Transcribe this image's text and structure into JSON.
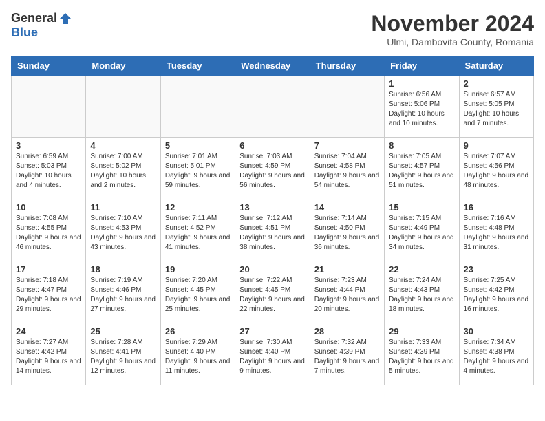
{
  "header": {
    "logo_general": "General",
    "logo_blue": "Blue",
    "month_title": "November 2024",
    "location": "Ulmi, Dambovita County, Romania"
  },
  "days_of_week": [
    "Sunday",
    "Monday",
    "Tuesday",
    "Wednesday",
    "Thursday",
    "Friday",
    "Saturday"
  ],
  "weeks": [
    [
      {
        "day": "",
        "info": ""
      },
      {
        "day": "",
        "info": ""
      },
      {
        "day": "",
        "info": ""
      },
      {
        "day": "",
        "info": ""
      },
      {
        "day": "",
        "info": ""
      },
      {
        "day": "1",
        "info": "Sunrise: 6:56 AM\nSunset: 5:06 PM\nDaylight: 10 hours and 10 minutes."
      },
      {
        "day": "2",
        "info": "Sunrise: 6:57 AM\nSunset: 5:05 PM\nDaylight: 10 hours and 7 minutes."
      }
    ],
    [
      {
        "day": "3",
        "info": "Sunrise: 6:59 AM\nSunset: 5:03 PM\nDaylight: 10 hours and 4 minutes."
      },
      {
        "day": "4",
        "info": "Sunrise: 7:00 AM\nSunset: 5:02 PM\nDaylight: 10 hours and 2 minutes."
      },
      {
        "day": "5",
        "info": "Sunrise: 7:01 AM\nSunset: 5:01 PM\nDaylight: 9 hours and 59 minutes."
      },
      {
        "day": "6",
        "info": "Sunrise: 7:03 AM\nSunset: 4:59 PM\nDaylight: 9 hours and 56 minutes."
      },
      {
        "day": "7",
        "info": "Sunrise: 7:04 AM\nSunset: 4:58 PM\nDaylight: 9 hours and 54 minutes."
      },
      {
        "day": "8",
        "info": "Sunrise: 7:05 AM\nSunset: 4:57 PM\nDaylight: 9 hours and 51 minutes."
      },
      {
        "day": "9",
        "info": "Sunrise: 7:07 AM\nSunset: 4:56 PM\nDaylight: 9 hours and 48 minutes."
      }
    ],
    [
      {
        "day": "10",
        "info": "Sunrise: 7:08 AM\nSunset: 4:55 PM\nDaylight: 9 hours and 46 minutes."
      },
      {
        "day": "11",
        "info": "Sunrise: 7:10 AM\nSunset: 4:53 PM\nDaylight: 9 hours and 43 minutes."
      },
      {
        "day": "12",
        "info": "Sunrise: 7:11 AM\nSunset: 4:52 PM\nDaylight: 9 hours and 41 minutes."
      },
      {
        "day": "13",
        "info": "Sunrise: 7:12 AM\nSunset: 4:51 PM\nDaylight: 9 hours and 38 minutes."
      },
      {
        "day": "14",
        "info": "Sunrise: 7:14 AM\nSunset: 4:50 PM\nDaylight: 9 hours and 36 minutes."
      },
      {
        "day": "15",
        "info": "Sunrise: 7:15 AM\nSunset: 4:49 PM\nDaylight: 9 hours and 34 minutes."
      },
      {
        "day": "16",
        "info": "Sunrise: 7:16 AM\nSunset: 4:48 PM\nDaylight: 9 hours and 31 minutes."
      }
    ],
    [
      {
        "day": "17",
        "info": "Sunrise: 7:18 AM\nSunset: 4:47 PM\nDaylight: 9 hours and 29 minutes."
      },
      {
        "day": "18",
        "info": "Sunrise: 7:19 AM\nSunset: 4:46 PM\nDaylight: 9 hours and 27 minutes."
      },
      {
        "day": "19",
        "info": "Sunrise: 7:20 AM\nSunset: 4:45 PM\nDaylight: 9 hours and 25 minutes."
      },
      {
        "day": "20",
        "info": "Sunrise: 7:22 AM\nSunset: 4:45 PM\nDaylight: 9 hours and 22 minutes."
      },
      {
        "day": "21",
        "info": "Sunrise: 7:23 AM\nSunset: 4:44 PM\nDaylight: 9 hours and 20 minutes."
      },
      {
        "day": "22",
        "info": "Sunrise: 7:24 AM\nSunset: 4:43 PM\nDaylight: 9 hours and 18 minutes."
      },
      {
        "day": "23",
        "info": "Sunrise: 7:25 AM\nSunset: 4:42 PM\nDaylight: 9 hours and 16 minutes."
      }
    ],
    [
      {
        "day": "24",
        "info": "Sunrise: 7:27 AM\nSunset: 4:42 PM\nDaylight: 9 hours and 14 minutes."
      },
      {
        "day": "25",
        "info": "Sunrise: 7:28 AM\nSunset: 4:41 PM\nDaylight: 9 hours and 12 minutes."
      },
      {
        "day": "26",
        "info": "Sunrise: 7:29 AM\nSunset: 4:40 PM\nDaylight: 9 hours and 11 minutes."
      },
      {
        "day": "27",
        "info": "Sunrise: 7:30 AM\nSunset: 4:40 PM\nDaylight: 9 hours and 9 minutes."
      },
      {
        "day": "28",
        "info": "Sunrise: 7:32 AM\nSunset: 4:39 PM\nDaylight: 9 hours and 7 minutes."
      },
      {
        "day": "29",
        "info": "Sunrise: 7:33 AM\nSunset: 4:39 PM\nDaylight: 9 hours and 5 minutes."
      },
      {
        "day": "30",
        "info": "Sunrise: 7:34 AM\nSunset: 4:38 PM\nDaylight: 9 hours and 4 minutes."
      }
    ]
  ]
}
